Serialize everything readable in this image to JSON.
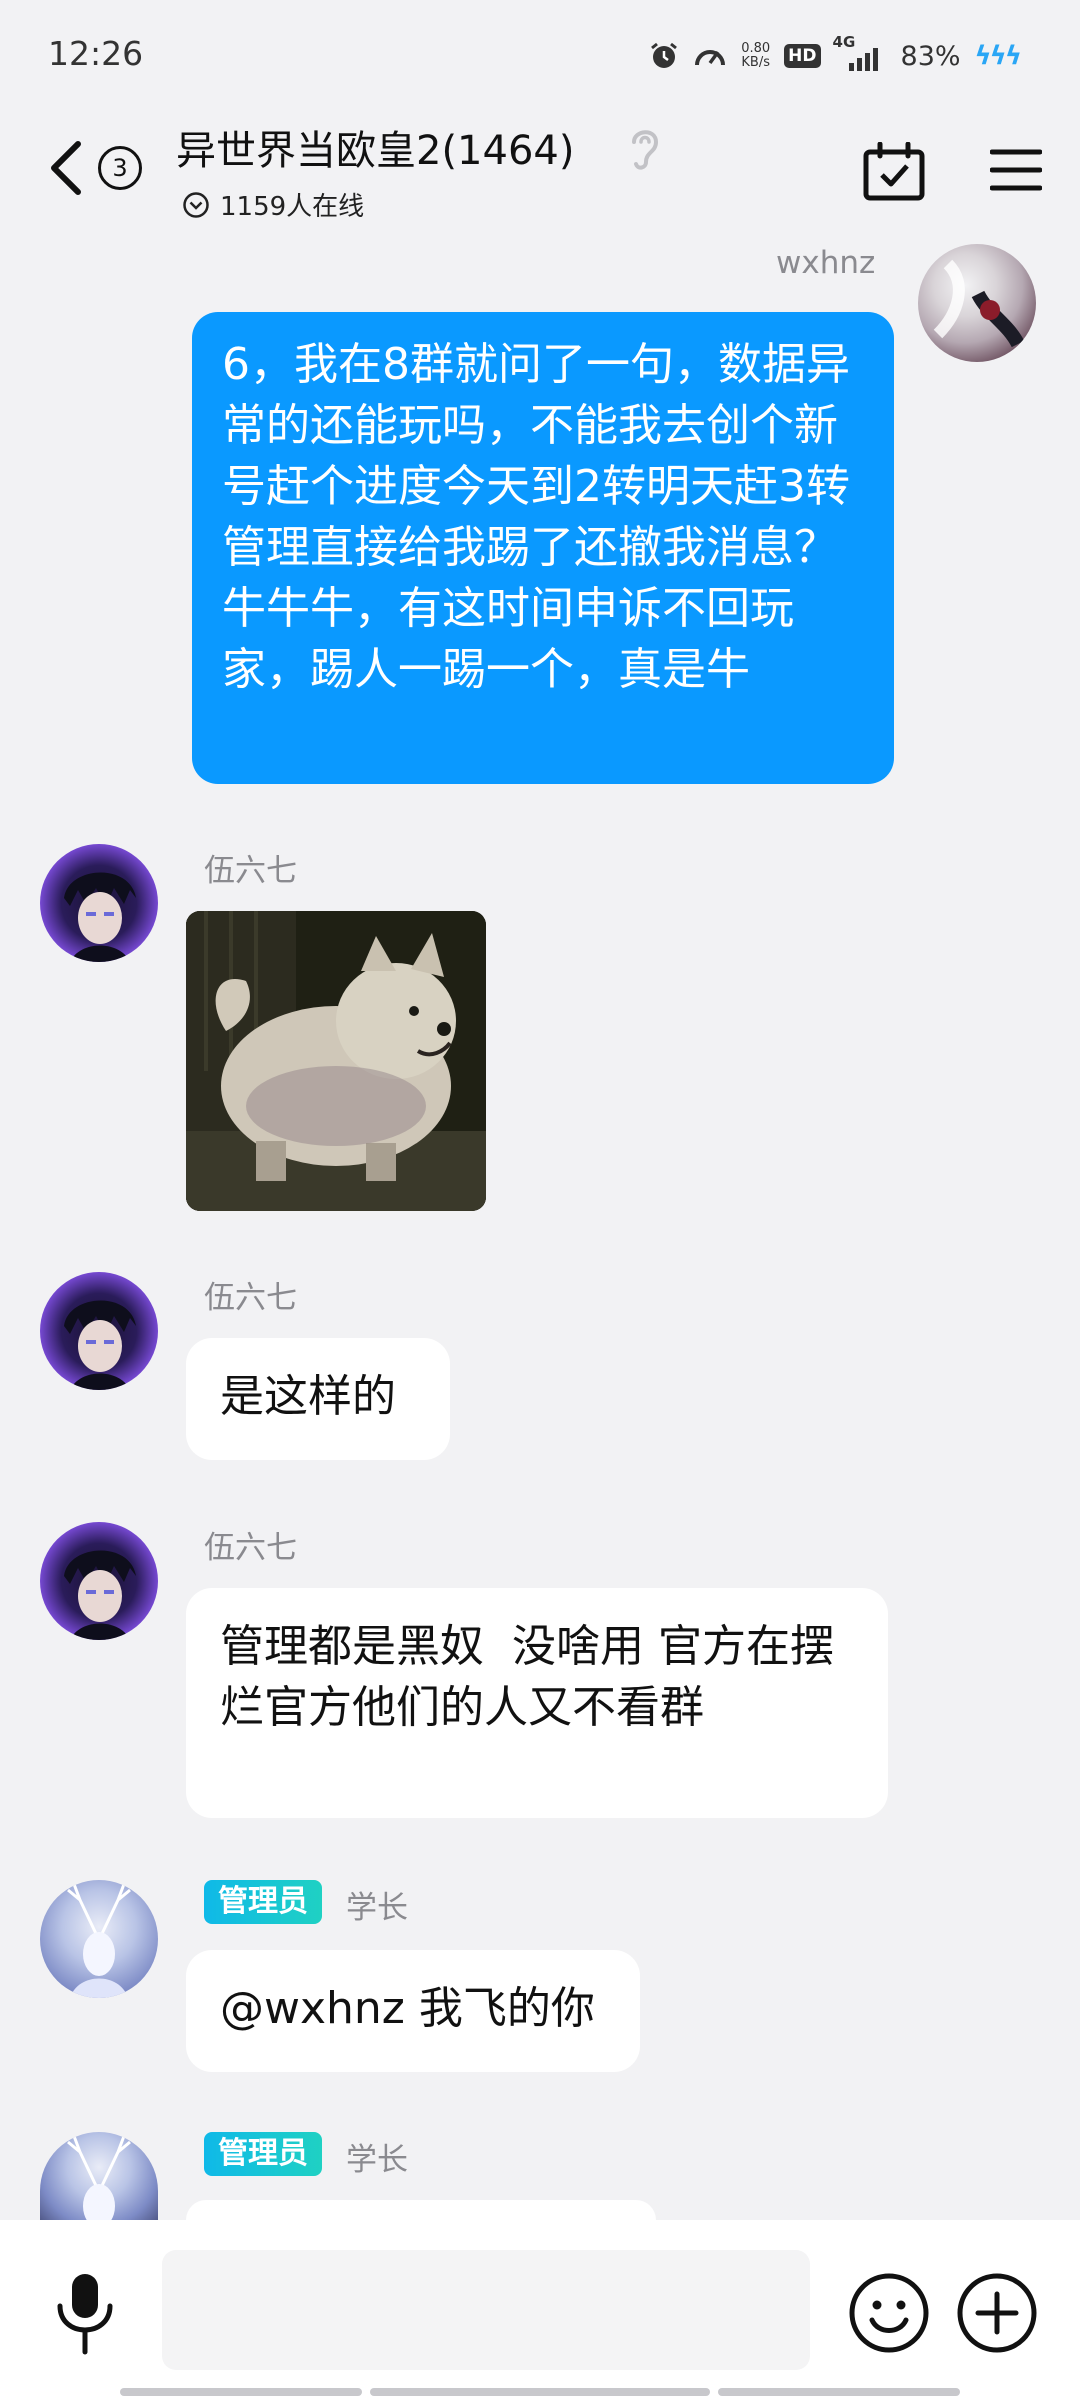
{
  "status_bar": {
    "time": "12:26",
    "net_speed_value": "0.80",
    "net_speed_unit": "KB/s",
    "hd": "HD",
    "signal": "4G",
    "battery": "83%"
  },
  "header": {
    "unread_count": "3",
    "title": "异世界当欧皇2(1464)",
    "online": "1159人在线"
  },
  "messages": [
    {
      "sender": "wxhnz",
      "text": "6，我在8群就问了一句，数据异常的还能玩吗，不能我去创个新号赶个进度今天到2转明天赶3转管理直接给我踢了还撤我消息？牛牛牛，有这时间申诉不回玩家，踢人一踢一个，真是牛"
    },
    {
      "sender": "伍六七",
      "type": "sticker"
    },
    {
      "sender": "伍六七",
      "text": "是这样的"
    },
    {
      "sender": "伍六七",
      "text": "管理都是黑奴  没啥用 官方在摆烂官方他们的人又不看群"
    },
    {
      "badge": "管理员",
      "sender": "学长",
      "text": "@wxhnz 我飞的你"
    },
    {
      "badge": "管理员",
      "sender": "学长"
    }
  ],
  "colors": {
    "self_bubble": "#0a99ff",
    "background": "#f2f2f4",
    "admin_badge": "#11bfe0"
  }
}
